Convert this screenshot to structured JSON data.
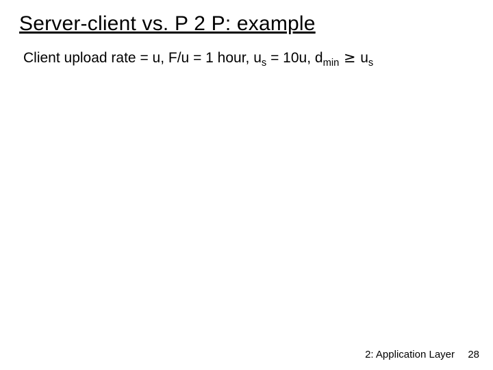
{
  "title": "Server-client vs. P 2 P: example",
  "body": {
    "prefix": "Client upload rate = u,  F/u = 1 hour,  u",
    "sub1": "s",
    "mid1": " = 10u,  d",
    "sub2": "min",
    "ge": " ≥ ",
    "u2": "u",
    "sub3": "s"
  },
  "footer": {
    "label": "2: Application Layer",
    "page": "28"
  }
}
